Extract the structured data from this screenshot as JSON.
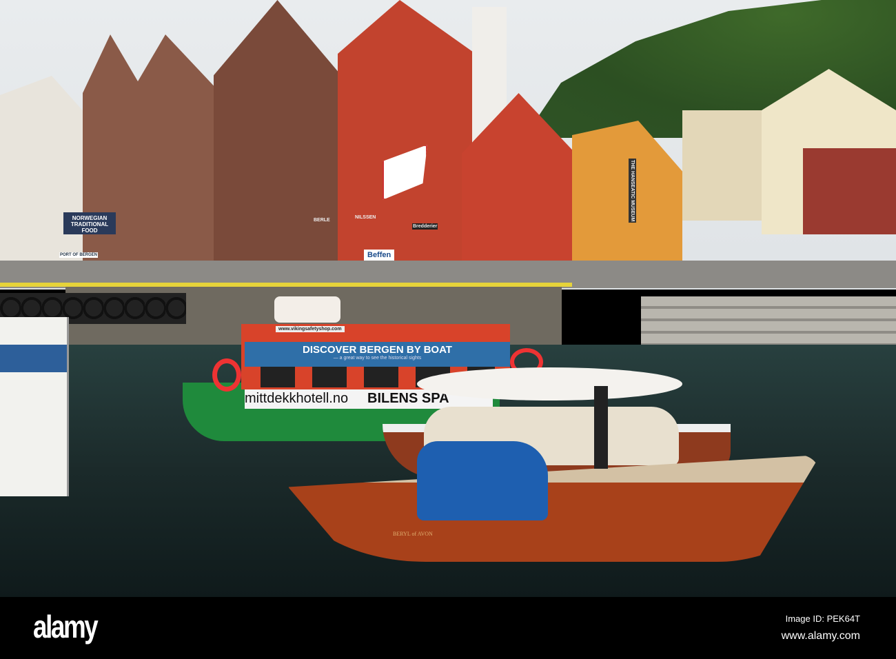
{
  "scene": {
    "stall_sign": "NORWEGIAN TRADITIONAL FOOD",
    "port_sign": "PORT OF BERGEN",
    "shop_signs": [
      "BERLE",
      "NILSSEN",
      "Bredderier"
    ],
    "museum_sign": "THE HANSEATIC MUSEUM",
    "kiosk_sign": "Beffen",
    "boat_banner": "DISCOVER BERGEN BY BOAT",
    "boat_banner_sub": "— a great way to see the historical sights",
    "boat_url": "www.vikingsafetyshop.com",
    "hull_text_1": "mittdekkhotell.no",
    "hull_text_2": "BILENS SPA",
    "wooden_boat_name": "BERYL of AVON"
  },
  "watermark": {
    "logo": "alamy",
    "image_id": "Image ID: PEK64T",
    "url": "www.alamy.com"
  },
  "colors": {
    "red_building": "#c2432e",
    "brown_building": "#7a4a3a",
    "boat_blue": "#2f6fa8",
    "hull_green": "#1f8a3c"
  }
}
